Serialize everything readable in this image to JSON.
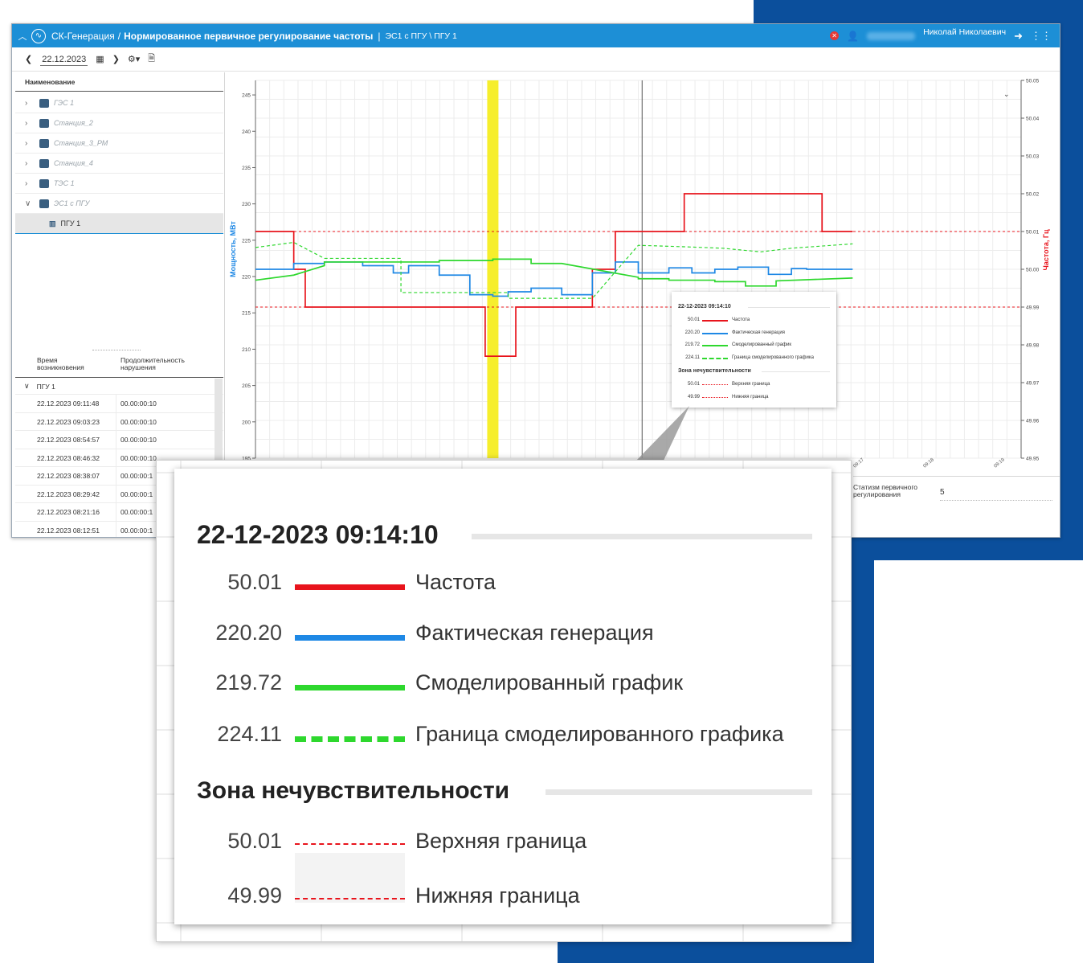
{
  "header": {
    "app_name": "СК-Генерация",
    "title_separator": "/",
    "page_title": "Нормированное первичное регулирование частоты",
    "title_bar": "|",
    "path": "ЭС1 с ПГУ \\ ПГУ 1",
    "user_name": "Николай Николаевич"
  },
  "toolbar": {
    "date": "22.12.2023"
  },
  "tree": {
    "column": "Наименование",
    "items": [
      {
        "label": "ГЭС 1",
        "expanded": false
      },
      {
        "label": "Станция_2",
        "expanded": false
      },
      {
        "label": "Станция_3_РМ",
        "expanded": false
      },
      {
        "label": "Станция_4",
        "expanded": false
      },
      {
        "label": "ТЭС 1",
        "expanded": false
      },
      {
        "label": "ЭС1 с ПГУ",
        "expanded": true
      }
    ],
    "selected_child": "ПГУ 1"
  },
  "log": {
    "col_time_1": "Время",
    "col_time_2": "возникновения",
    "col_dur_1": "Продолжительность",
    "col_dur_2": "нарушения",
    "group": "ПГУ 1",
    "rows": [
      {
        "time": "22.12.2023 09:11:48",
        "duration": "00.00:00:10"
      },
      {
        "time": "22.12.2023 09:03:23",
        "duration": "00.00:00:10"
      },
      {
        "time": "22.12.2023 08:54:57",
        "duration": "00.00:00:10"
      },
      {
        "time": "22.12.2023 08:46:32",
        "duration": "00.00:00:10"
      },
      {
        "time": "22.12.2023 08:38:07",
        "duration": "00.00:00:1"
      },
      {
        "time": "22.12.2023 08:29:42",
        "duration": "00.00:00:1"
      },
      {
        "time": "22.12.2023 08:21:16",
        "duration": "00.00:00:1"
      },
      {
        "time": "22.12.2023 08:12:51",
        "duration": "00.00:00:1"
      }
    ]
  },
  "params": {
    "statism_label_1": "Статизм первичного",
    "statism_label_2": "регулирования",
    "statism_value": "5"
  },
  "tooltip": {
    "timestamp": "22-12-2023 09:14:10",
    "rows": [
      {
        "value": "50.01",
        "name": "Частота",
        "color": "#e8141c",
        "style": "solid"
      },
      {
        "value": "220.20",
        "name": "Фактическая генерация",
        "color": "#1e88e5",
        "style": "solid"
      },
      {
        "value": "219.72",
        "name": "Смоделированный график",
        "color": "#2ed82e",
        "style": "solid"
      },
      {
        "value": "224.11",
        "name": "Граница смоделированного графика",
        "color": "#2ed82e",
        "style": "dashed"
      }
    ],
    "zone_title": "Зона нечувствительности",
    "zone_rows": [
      {
        "value": "50.01",
        "name": "Верхняя граница",
        "color": "#e8141c",
        "style": "dotted"
      },
      {
        "value": "49.99",
        "name": "Нижняя граница",
        "color": "#e8141c",
        "style": "dotted"
      }
    ]
  },
  "chart_data": {
    "type": "line",
    "ylabel": "Мощность, МВт",
    "y2label": "Частота, Гц",
    "ylim": [
      195,
      247
    ],
    "y2lim": [
      49.95,
      50.05
    ],
    "yticks": [
      245,
      240,
      235,
      230,
      225,
      220,
      215,
      210,
      205,
      200,
      195
    ],
    "y2ticks": [
      "50.05",
      "50.04",
      "50.03",
      "50.02",
      "50.01",
      "50.00",
      "49.99",
      "49.98",
      "49.97",
      "49.96",
      "49.95"
    ],
    "xticks": [
      "09:17",
      "09:18",
      "09:19"
    ],
    "xlim": [
      0,
      100
    ],
    "grid": true,
    "highlight_x": 31,
    "cursor_x": 50.5,
    "deadband": [
      50.01,
      49.99
    ],
    "series": [
      {
        "name": "Частота",
        "axis": "right",
        "color": "#e8141c",
        "style": "solid",
        "x": [
          0,
          5,
          5,
          6.5,
          6.5,
          30,
          30,
          34,
          34,
          44,
          44,
          47,
          47,
          51,
          51,
          56,
          56,
          74,
          74,
          78
        ],
        "y": [
          50.01,
          50.01,
          50.0,
          50.0,
          49.99,
          49.99,
          49.977,
          49.977,
          49.99,
          49.99,
          50.0,
          50.0,
          50.01,
          50.01,
          50.01,
          50.01,
          50.02,
          50.02,
          50.01,
          50.01
        ]
      },
      {
        "name": "Фактическая генерация",
        "axis": "left",
        "color": "#1e88e5",
        "style": "solid",
        "x": [
          0,
          5,
          5,
          9,
          9,
          14,
          14,
          18,
          18,
          20,
          20,
          24,
          24,
          28,
          28,
          31,
          31,
          33,
          33,
          36,
          36,
          40,
          40,
          44,
          44,
          47,
          47,
          50,
          50,
          54,
          54,
          57,
          57,
          60,
          60,
          63,
          63,
          67,
          67,
          70,
          70,
          72,
          72,
          78
        ],
        "y": [
          221,
          221,
          221.8,
          221.8,
          222,
          222,
          221.5,
          221.5,
          220.5,
          220.5,
          221.5,
          221.5,
          220.2,
          220.2,
          217.5,
          217.5,
          217.3,
          217.3,
          217.9,
          217.9,
          218.4,
          218.4,
          217.5,
          217.5,
          220.5,
          220.5,
          222,
          222,
          220.5,
          220.5,
          221.2,
          221.2,
          220.5,
          220.5,
          221,
          221,
          221.3,
          221.3,
          220.3,
          220.3,
          221.1,
          221.1,
          221,
          221
        ]
      },
      {
        "name": "Смоделированный график",
        "axis": "left",
        "color": "#2ed82e",
        "style": "solid",
        "x": [
          0,
          5,
          9,
          9,
          19,
          24,
          24,
          31,
          31,
          36,
          36,
          40,
          50,
          50,
          54,
          54,
          60,
          60,
          64,
          64,
          68,
          68,
          78
        ],
        "y": [
          219.5,
          220.2,
          221.5,
          222,
          222,
          222,
          222.2,
          222.2,
          222.4,
          222.4,
          221.8,
          221.8,
          219.9,
          219.7,
          219.7,
          219.5,
          219.5,
          219.3,
          219.3,
          218.7,
          218.7,
          219.4,
          219.8
        ]
      },
      {
        "name": "Граница смоделированного графика",
        "axis": "left",
        "color": "#2ed82e",
        "style": "dashed",
        "x": [
          0,
          5,
          9,
          19,
          19,
          24,
          24,
          33,
          33,
          40,
          40,
          44,
          50,
          50,
          56,
          56,
          61,
          61,
          66,
          66,
          70,
          70,
          78
        ],
        "y": [
          224,
          224.7,
          222.5,
          222.5,
          217.8,
          217.8,
          217.8,
          217.8,
          217,
          217,
          217,
          217,
          224.3,
          224.3,
          224.1,
          224.1,
          223.9,
          223.9,
          223.4,
          223.4,
          223.9,
          223.9,
          224.5
        ]
      }
    ]
  }
}
